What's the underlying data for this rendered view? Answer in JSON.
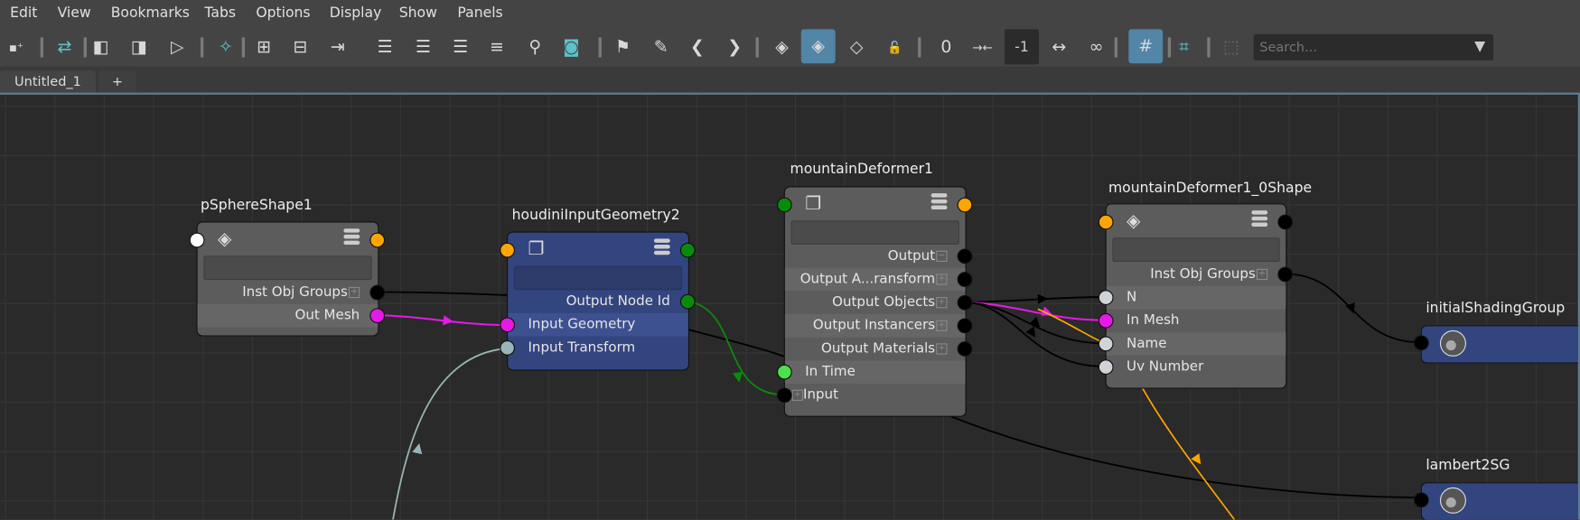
{
  "menu": [
    "Edit",
    "View",
    "Bookmarks",
    "Tabs",
    "Options",
    "Display",
    "Show",
    "Panels"
  ],
  "toolbar": {
    "icons": [
      "add-selected-icon",
      "input-output-connections-icon",
      "graph-upstream-icon",
      "graph-both-icon",
      "graph-downstream-icon",
      "frame-all-icon",
      "add-attribute-icon",
      "remove-attribute-icon",
      "pin-icon",
      "simple-mode-icon",
      "connected-mode-icon",
      "all-attributes-icon",
      "custom-attributes-icon",
      "search-icon",
      "toggle-swatch-icon",
      "add-bookmark-icon",
      "edit-bookmark-icon",
      "previous-bookmark-icon",
      "next-bookmark-icon",
      "show-shapes-icon",
      "show-transforms-icon",
      "hide-nodes-icon",
      "lock-icon",
      "zero-spacing-icon",
      "contract-icon",
      "expand-icon",
      "infinite-icon",
      "grid-snap-icon",
      "snap-magnet-icon",
      "frame-icon"
    ],
    "active": [
      "show-transforms-icon",
      "grid-snap-icon"
    ],
    "spacing_value": "-1",
    "search_placeholder": "Search..."
  },
  "tabs": [
    {
      "label": "Untitled_1",
      "active": true
    },
    {
      "label": "+"
    }
  ],
  "colors": {
    "accent": "#5285a6",
    "mesh_port": "#e619e6",
    "time_port": "#4ce04c",
    "message_port": "#ffa500",
    "node_id_port": "#0a8a0a",
    "matrix_port": "#9ab5b5"
  },
  "nodes": [
    {
      "id": "pSphereShape1",
      "title": "pSphereShape1",
      "style": "grey",
      "icon": "mesh-icon",
      "rows": [
        {
          "label": "Inst Obj Groups",
          "side": "out",
          "expand": true
        },
        {
          "label": "Out Mesh",
          "side": "out",
          "port": "mesh"
        }
      ]
    },
    {
      "id": "houdiniInputGeometry2",
      "title": "houdiniInputGeometry2",
      "style": "blue",
      "icon": "houdini-asset-icon",
      "rows": [
        {
          "label": "Output Node Id",
          "side": "out",
          "port": "node_id"
        },
        {
          "label": "Input Geometry",
          "side": "in",
          "port": "mesh"
        },
        {
          "label": "Input Transform",
          "side": "in",
          "port": "matrix"
        }
      ]
    },
    {
      "id": "mountainDeformer1",
      "title": "mountainDeformer1",
      "style": "grey",
      "icon": "houdini-asset-icon",
      "rows": [
        {
          "label": "Output",
          "side": "out",
          "collapse": true
        },
        {
          "label": "Output A...ransform",
          "side": "out",
          "expand": true
        },
        {
          "label": "Output Objects",
          "side": "out",
          "expand": true
        },
        {
          "label": "Output Instancers",
          "side": "out",
          "expand": true
        },
        {
          "label": "Output Materials",
          "side": "out",
          "expand": true
        },
        {
          "label": "In Time",
          "side": "in",
          "port": "time"
        },
        {
          "label": "Input",
          "side": "in",
          "expand": true
        }
      ]
    },
    {
      "id": "mountainDeformer1_0Shape",
      "title": "mountainDeformer1_0Shape",
      "style": "grey",
      "icon": "mesh-icon",
      "rows": [
        {
          "label": "Inst Obj Groups",
          "side": "out",
          "expand": true
        },
        {
          "label": "N",
          "side": "in",
          "port": "light"
        },
        {
          "label": "In Mesh",
          "side": "in",
          "port": "mesh"
        },
        {
          "label": "Name",
          "side": "in",
          "port": "light"
        },
        {
          "label": "Uv Number",
          "side": "in",
          "port": "light"
        }
      ]
    },
    {
      "id": "initialShadingGroup",
      "title": "initialShadingGroup",
      "style": "shading-group",
      "icon": "shading-group-icon"
    },
    {
      "id": "lambert2SG",
      "title": "lambert2SG",
      "style": "shading-group",
      "icon": "shading-group-icon"
    }
  ]
}
